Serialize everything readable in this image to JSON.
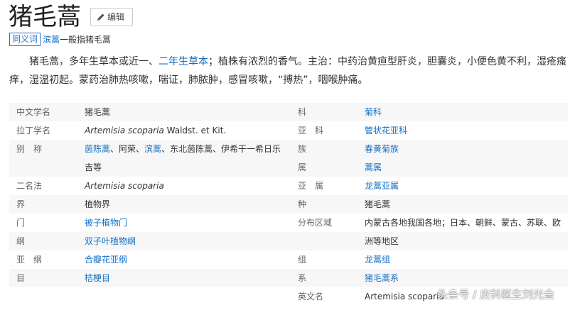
{
  "header": {
    "title": "猪毛蒿",
    "edit_label": "编辑"
  },
  "synonym": {
    "tag": "同义词",
    "link": "滨蒿",
    "text": "一般指猪毛蒿"
  },
  "summary": {
    "part1": "猪毛蒿，多年生草本或近一、",
    "link": "二年生草本",
    "part2": "；植株有浓烈的香气。主治：中药治黄疸型肝炎，胆囊炎，小便色黄不利，湿疮瘙痒，湿温初起。蒙药治肺热咳嗽，喘证，肺脓肿，感冒咳嗽，“搏热”，咽喉肿痛。"
  },
  "basic_info": {
    "left": [
      {
        "label": "中文学名",
        "value": "猪毛蒿",
        "link": false
      },
      {
        "label": "拉丁学名",
        "value_italic": "Artemisia scoparia",
        "value_rest": " Waldst. et Kit.",
        "link": false
      },
      {
        "label": "别　称",
        "parts": [
          "茵陈蒿",
          "、阿荣、",
          "滨蒿",
          "、东北茵陈蒿、伊希干一希日乐"
        ],
        "cont": "吉等"
      },
      {
        "label": "二名法",
        "value_italic": "Artemisia scoparia",
        "link": false
      },
      {
        "label": "界",
        "value": "植物界",
        "link": false
      },
      {
        "label": "门",
        "value": "被子植物门",
        "link": true
      },
      {
        "label": "纲",
        "value": "双子叶植物纲",
        "link": true
      },
      {
        "label": "亚　纲",
        "value": "合瓣花亚纲",
        "link": true
      },
      {
        "label": "目",
        "value": "桔梗目",
        "link": true
      }
    ],
    "right": [
      {
        "label": "科",
        "value": "菊科",
        "link": true
      },
      {
        "label": "亚　科",
        "value": "管状花亚科",
        "link": true
      },
      {
        "label": "族",
        "value": "春黄菊族",
        "link": true
      },
      {
        "label": "属",
        "value": "蒿属",
        "link": true
      },
      {
        "label": "亚　属",
        "value": "龙蒿亚属",
        "link": true
      },
      {
        "label": "种",
        "value": "猪毛蒿",
        "link": false
      },
      {
        "label": "分布区域",
        "value": "内蒙古各地我国各地；日本、朝鲜、蒙古、苏联、欧",
        "cont": "洲等地区",
        "link": false
      },
      {
        "label": "组",
        "value": "龙蒿组",
        "link": true
      },
      {
        "label": "系",
        "value": "猪毛蒿系",
        "link": true
      },
      {
        "label": "英文名",
        "value": "Artemisia scoparia",
        "link": false
      }
    ]
  },
  "watermark": "头条号 / 皮科医生刘光金",
  "colors": {
    "link": "#136ec2",
    "tag_border": "#2c72c7"
  }
}
